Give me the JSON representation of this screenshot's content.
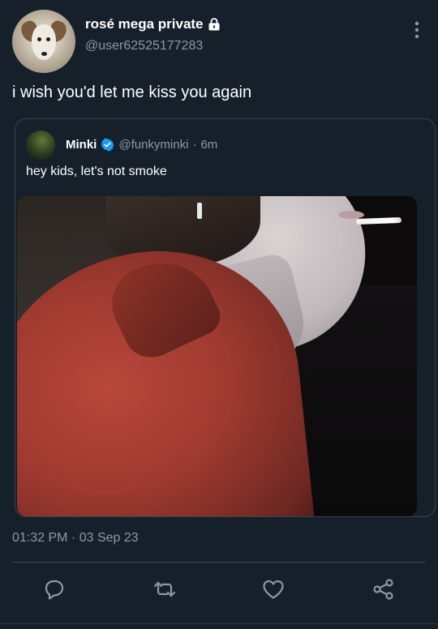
{
  "tweet": {
    "display_name": "rosé mega private",
    "handle": "@user62525177283",
    "text": "i wish you'd let me kiss you again",
    "timestamp": "01:32 PM · 03 Sep 23"
  },
  "quoted": {
    "name": "Minki",
    "handle": "@funkyminki",
    "separator": "·",
    "time": "6m",
    "text": "hey kids, let's not smoke"
  },
  "icons": {
    "lock": "lock-icon",
    "more": "more-vertical-icon",
    "verified": "verified-badge-icon",
    "reply": "reply-icon",
    "retweet": "retweet-icon",
    "like": "heart-icon",
    "share": "share-icon"
  },
  "colors": {
    "background": "#15202b",
    "secondary_text": "#8b98a5",
    "border": "#38444d",
    "verified": "#1d9bf0"
  }
}
